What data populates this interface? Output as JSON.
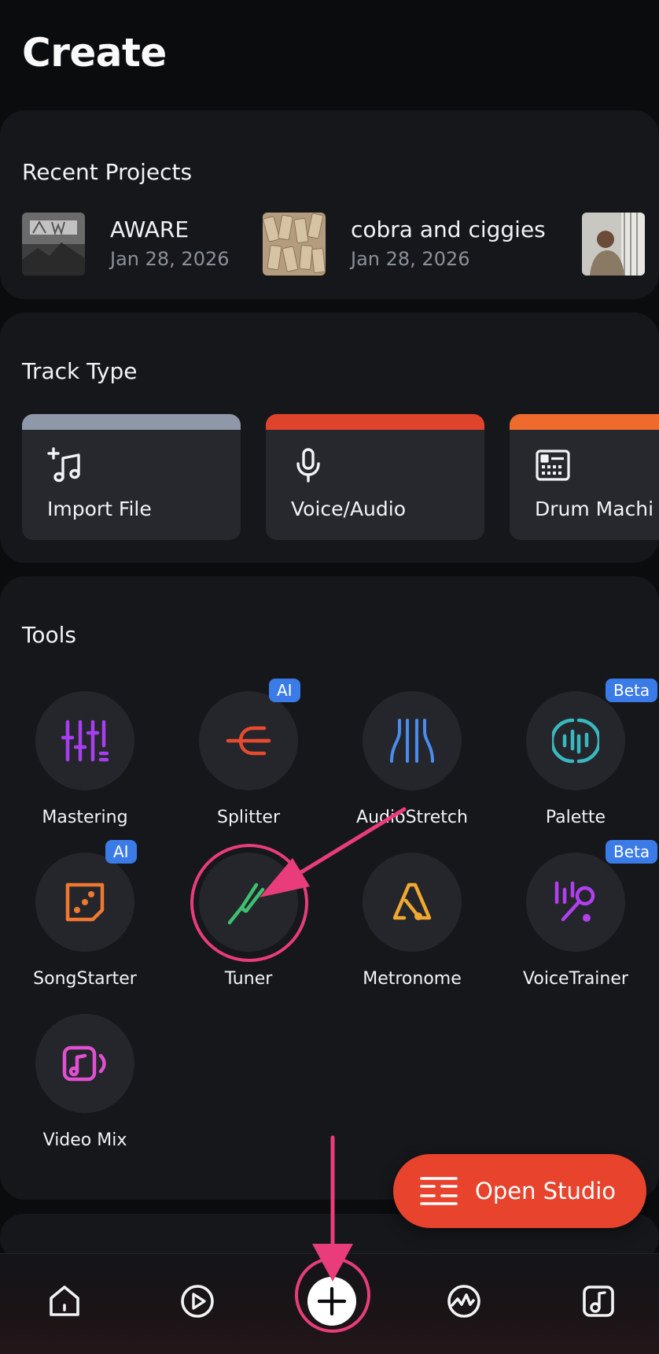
{
  "header": {
    "title": "Create"
  },
  "recent": {
    "title": "Recent Projects",
    "projects": [
      {
        "name": "AWARE",
        "date": "Jan 28, 2026"
      },
      {
        "name": "cobra and ciggies",
        "date": "Jan 28, 2026"
      }
    ]
  },
  "track_type": {
    "title": "Track Type",
    "items": [
      {
        "label": "Import File",
        "icon": "music-plus-icon",
        "color": "#8f98a8"
      },
      {
        "label": "Voice/Audio",
        "icon": "microphone-icon",
        "color": "#e0432c"
      },
      {
        "label": "Drum Machi",
        "icon": "drum-machine-icon",
        "color": "#ee6a2d"
      }
    ]
  },
  "tools": {
    "title": "Tools",
    "items": [
      {
        "label": "Mastering",
        "icon": "mastering-sliders-icon",
        "color": "#a83ef0",
        "badge": ""
      },
      {
        "label": "Splitter",
        "icon": "splitter-icon",
        "color": "#e84a30",
        "badge": "AI"
      },
      {
        "label": "AudioStretch",
        "icon": "audiostretch-icon",
        "color": "#4a8cf0",
        "badge": ""
      },
      {
        "label": "Palette",
        "icon": "palette-icon",
        "color": "#3ab8c0",
        "badge": "Beta"
      },
      {
        "label": "SongStarter",
        "icon": "dice-icon",
        "color": "#f07830",
        "badge": "AI"
      },
      {
        "label": "Tuner",
        "icon": "tuning-fork-icon",
        "color": "#3ec070",
        "badge": ""
      },
      {
        "label": "Metronome",
        "icon": "metronome-icon",
        "color": "#f0a830",
        "badge": ""
      },
      {
        "label": "VoiceTrainer",
        "icon": "voicetrainer-icon",
        "color": "#b040f0",
        "badge": "Beta"
      },
      {
        "label": "Video Mix",
        "icon": "video-music-icon",
        "color": "#e050d0",
        "badge": ""
      }
    ]
  },
  "open_studio": {
    "label": "Open Studio",
    "color": "#e8432d"
  },
  "nav": {
    "items": [
      {
        "name": "home",
        "icon": "home-icon"
      },
      {
        "name": "play",
        "icon": "play-circle-icon"
      },
      {
        "name": "create",
        "icon": "plus-icon"
      },
      {
        "name": "activity",
        "icon": "activity-icon"
      },
      {
        "name": "library",
        "icon": "music-note-icon"
      }
    ]
  },
  "annotation": {
    "color": "#e83d7a"
  }
}
